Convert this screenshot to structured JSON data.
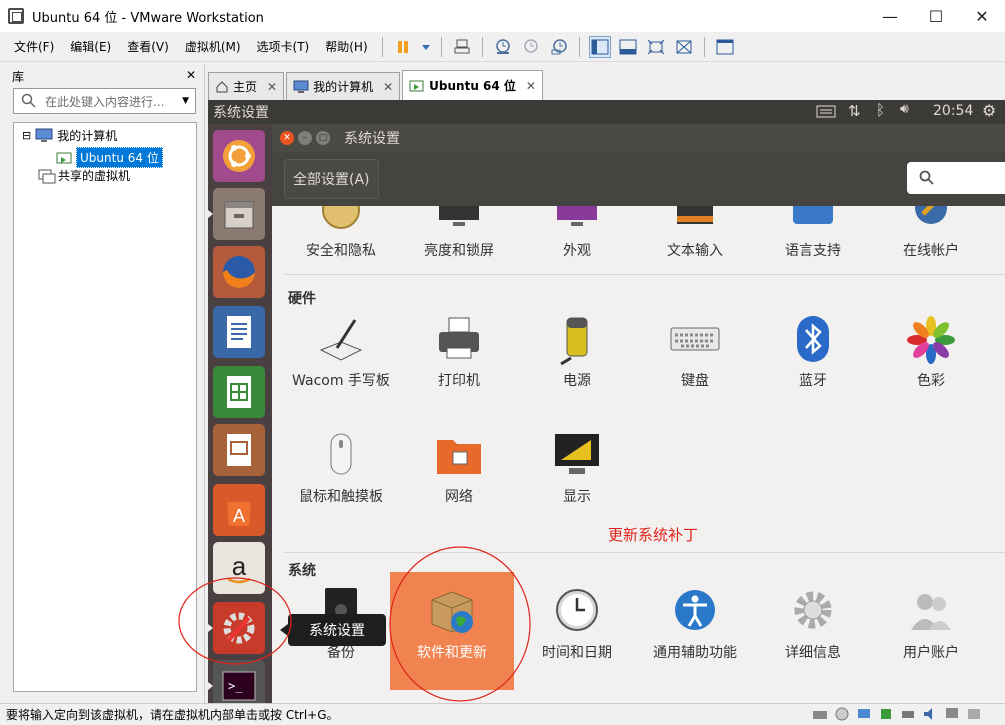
{
  "window": {
    "title": "Ubuntu 64 位 - VMware Workstation",
    "minimize": "—",
    "maximize": "☐",
    "close": "✕"
  },
  "menu": [
    "文件(F)",
    "编辑(E)",
    "查看(V)",
    "虚拟机(M)",
    "选项卡(T)",
    "帮助(H)"
  ],
  "library": {
    "title": "库",
    "close": "✕",
    "search_placeholder": "在此处键入内容进行...",
    "tree": {
      "root_toggle": "⊟",
      "my_computer": "我的计算机",
      "vm": "Ubuntu 64 位",
      "shared": "共享的虚拟机"
    }
  },
  "tabs": [
    {
      "label": "主页",
      "close": "✕"
    },
    {
      "label": "我的计算机",
      "close": "✕"
    },
    {
      "label": "Ubuntu 64 位",
      "close": "✕"
    }
  ],
  "ubuntu": {
    "topbar_title": "系统设置",
    "clock": "20:54",
    "window_title": "系统设置",
    "all_settings": "全部设置(A)",
    "top_row": [
      "安全和隐私",
      "亮度和锁屏",
      "外观",
      "文本输入",
      "语言支持",
      "在线帐户"
    ],
    "hardware": {
      "title": "硬件",
      "items": [
        "Wacom 手写板",
        "打印机",
        "电源",
        "键盘",
        "蓝牙",
        "色彩",
        "鼠标和触摸板",
        "网络",
        "显示"
      ]
    },
    "system": {
      "title": "系统",
      "items": [
        "备份",
        "软件和更新",
        "时间和日期",
        "通用辅助功能",
        "详细信息",
        "用户账户"
      ]
    },
    "annotation": "更新系统补丁",
    "tooltip": "系统设置"
  },
  "status": {
    "message": "要将输入定向到该虚拟机，请在虚拟机内部单击或按 Ctrl+G。"
  },
  "colors": {
    "annotation_red": "#e0231a",
    "highlight_orange": "#f0834f",
    "ubuntu_dark": "#3c3b37",
    "launcher": "#4a4041"
  }
}
